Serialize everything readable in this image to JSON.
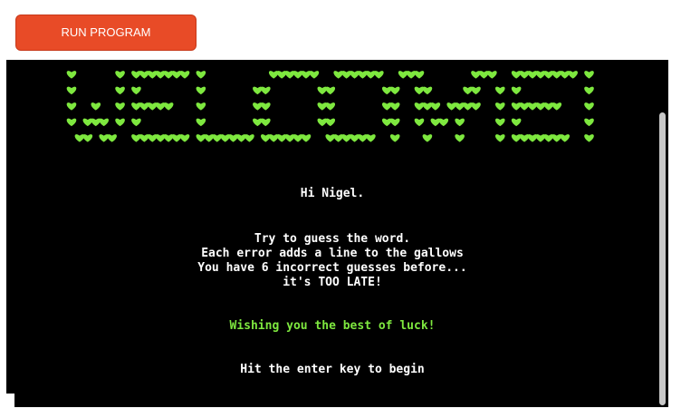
{
  "toolbar": {
    "run_label": "RUN PROGRAM"
  },
  "colors": {
    "button": "#e84b27",
    "terminal_bg": "#000000",
    "heart_green": "#7ee83f",
    "text": "#ffffff"
  },
  "banner": {
    "text": "WELCOME!",
    "glyph": "heart-icon",
    "rows": [
      "X     X XXXXXXX X        XXXXXX  XXXXXX  XXX      XXX  XXXXXXXX X",
      "X     X X       X      XX      XX      XX  XX    XX  X X        X",
      "X  X  X XXXXX   X      XX      XX      XX  XXX XXXX  X XXXXXX   X",
      "X XXX X X       X      XX      XX      XX  X XX X    X X        X",
      " XX XX  XXXXXXX XXXXXXX XXXXXX  XXXXXX  X   X   X    X XXXXXXX  X"
    ]
  },
  "terminal": {
    "greeting": "Hi Nigel.",
    "intro": [
      "Try to guess the word.",
      "Each error adds a line to the gallows",
      "You have 6 incorrect guesses before...",
      "it's TOO LATE!"
    ],
    "wish": "Wishing you the best of luck!",
    "prompt": "Hit the enter key to begin"
  }
}
